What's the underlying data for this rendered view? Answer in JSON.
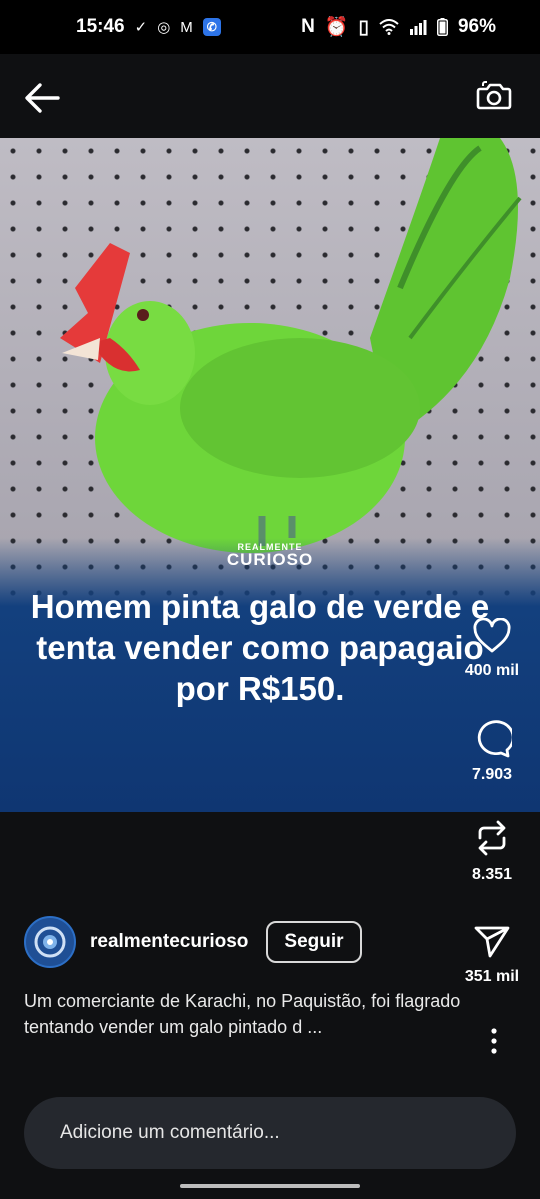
{
  "status_bar": {
    "time": "15:46",
    "left_icons": [
      "check-circle-icon",
      "instagram-icon",
      "gmail-icon",
      "phone-icon"
    ],
    "right_icons": [
      "nfc-icon",
      "alarm-icon",
      "vibrate-icon",
      "wifi-icon",
      "signal-icon",
      "battery-icon"
    ],
    "battery": "96%"
  },
  "post": {
    "brand_small": "REALMENTE",
    "brand_big": "CURIOSO",
    "headline": "Homem pinta galo de verde e tenta vender como papagaio por R$150.",
    "likes": "400 mil",
    "comments": "7.903",
    "reposts": "8.351",
    "shares": "351 mil",
    "username": "realmentecurioso",
    "follow_label": "Seguir",
    "caption": "Um comerciante de Karachi, no Paquistão, foi flagrado tentando vender um galo pintado d ..."
  },
  "comment": {
    "placeholder": "Adicione um comentário..."
  },
  "colors": {
    "background": "#0f1012",
    "banner": "#13407e",
    "bird_green": "#6ed63a",
    "comb_red": "#e53a3a"
  }
}
